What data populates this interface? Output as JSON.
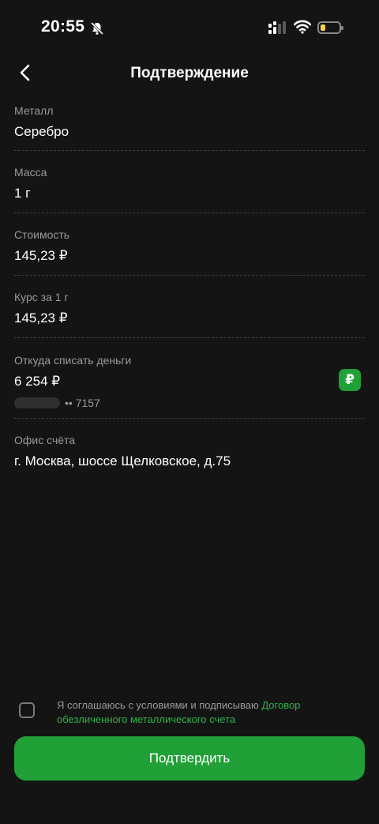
{
  "status_bar": {
    "time": "20:55"
  },
  "header": {
    "title": "Подтверждение"
  },
  "fields": [
    {
      "label": "Металл",
      "value": "Серебро"
    },
    {
      "label": "Масса",
      "value": "1 г"
    },
    {
      "label": "Стоимость",
      "value": "145,23 ₽"
    },
    {
      "label": "Курс за 1 г",
      "value": "145,23 ₽"
    }
  ],
  "source": {
    "label": "Откуда списать деньги",
    "amount": "6 254 ₽",
    "card_mask": "•• 7157",
    "currency_badge": "₽"
  },
  "office": {
    "label": "Офис счёта",
    "value": "г. Москва, шоссе Щелковское, д.75"
  },
  "agreement": {
    "text": "Я соглашаюсь с условиями и подписываю ",
    "link": "Договор обезличенного металлического счета"
  },
  "confirm_label": "Подтвердить",
  "colors": {
    "background": "#141414",
    "accent": "#21a038",
    "link": "#2db34a"
  }
}
